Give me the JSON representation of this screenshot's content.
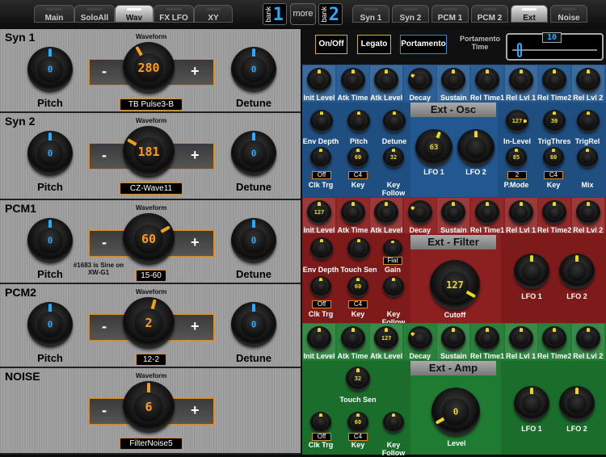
{
  "tabs": [
    {
      "label": "Main",
      "active": false
    },
    {
      "label": "SoloAll",
      "active": false
    },
    {
      "label": "Wav",
      "active": true
    },
    {
      "label": "FX LFO",
      "active": false
    },
    {
      "label": "XY",
      "active": false
    }
  ],
  "bank_left": {
    "label": "bank",
    "number": "1"
  },
  "more_label": "more",
  "bank_right": {
    "label": "bank",
    "number": "2"
  },
  "right_tabs": [
    {
      "label": "Syn 1",
      "active": false
    },
    {
      "label": "Syn 2",
      "active": false
    },
    {
      "label": "PCM 1",
      "active": false
    },
    {
      "label": "PCM 2",
      "active": false
    },
    {
      "label": "Ext",
      "active": true
    },
    {
      "label": "Noise",
      "active": false
    }
  ],
  "waveform_label": "Waveform",
  "minus": "-",
  "plus": "+",
  "pitch_label": "Pitch",
  "detune_label": "Detune",
  "osc": [
    {
      "title": "Syn 1",
      "wave_value": "280",
      "wave_name": "TB Pulse3-B",
      "pitch": "0",
      "detune": "0",
      "note": ""
    },
    {
      "title": "Syn 2",
      "wave_value": "181",
      "wave_name": "CZ-Wave11",
      "pitch": "0",
      "detune": "0",
      "note": ""
    },
    {
      "title": "PCM1",
      "wave_value": "60",
      "wave_name": "15-60",
      "pitch": "0",
      "detune": "0",
      "note": "#1683 is Sine on XW-G1"
    },
    {
      "title": "PCM2",
      "wave_value": "2",
      "wave_name": "12-2",
      "pitch": "0",
      "detune": "0",
      "note": ""
    },
    {
      "title": "NOISE",
      "wave_value": "6",
      "wave_name": "FilterNoise5",
      "pitch": "",
      "detune": "",
      "note": ""
    }
  ],
  "controls": {
    "onoff": "On/Off",
    "legato": "Legato",
    "portamento": "Portamento",
    "portamento_time_label": "Portamento Time",
    "portamento_time_value": "10"
  },
  "env_labels": [
    "Init Level",
    "Atk Time",
    "Atk Level",
    "Decay",
    "Sustain",
    "Rel Time1",
    "Rel Lvl 1",
    "Rel Time2",
    "Rel Lvl 2"
  ],
  "osc_section": {
    "title": "Ext - Osc",
    "env_depth": "Env Depth",
    "pitch": "Pitch",
    "detune": "Detune",
    "clk_trg": "Clk Trg",
    "clk_trg_val": "Off",
    "key": "Key",
    "key_val": "C4",
    "key_follow": "Key Follow",
    "lfo1": "LFO 1",
    "lfo2": "LFO 2",
    "lfo1_val": "63",
    "in_level": "In-Level",
    "in_level_val": "127",
    "trig_thres": "TrigThres",
    "trig_thres_val": "30",
    "trig_rel": "TrigRel",
    "p_mode": "P.Mode",
    "p_mode_val": "2",
    "p_mode_knob": "85",
    "key2": "Key",
    "key2_val": "C4",
    "key2_knob": "60",
    "mix": "Mix",
    "key_knob": "60",
    "kf_knob": "32"
  },
  "filter_section": {
    "title": "Ext - Filter",
    "env_depth": "Env Depth",
    "touch_sen": "Touch Sen",
    "gain": "Gain",
    "gain_val": "Flat",
    "clk_trg": "Clk Trg",
    "clk_trg_val": "Off",
    "key": "Key",
    "key_val": "C4",
    "key_follow": "Key Follow",
    "cutoff": "Cutoff",
    "cutoff_val": "127",
    "lfo1": "LFO 1",
    "lfo2": "LFO 2",
    "key_knob": "60",
    "env_init": "127"
  },
  "amp_section": {
    "title": "Ext - Amp",
    "touch_sen": "Touch Sen",
    "touch_sen_val": "32",
    "clk_trg": "Clk Trg",
    "clk_trg_val": "Off",
    "key": "Key",
    "key_val": "C4",
    "key_follow": "Key Follow",
    "level": "Level",
    "level_val": "0",
    "lfo1": "LFO 1",
    "lfo2": "LFO 2",
    "key_knob": "60",
    "atk_level": "127"
  },
  "colors": {
    "blue": "#23578f",
    "red": "#8c1f1f",
    "green": "#1f7a32",
    "accent_orange": "#f0a020",
    "accent_yellow": "#e8d820",
    "digit_blue": "#29aaff",
    "digit_orange": "#ff9a1a"
  }
}
